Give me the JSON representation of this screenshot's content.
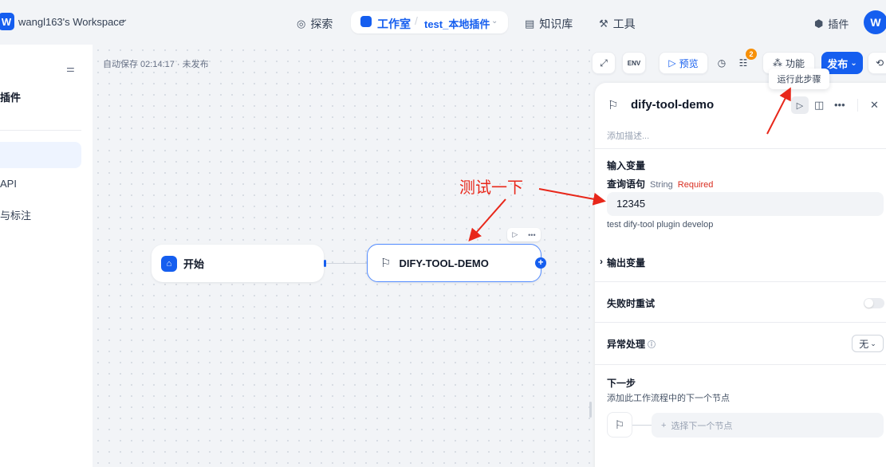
{
  "header": {
    "workspace_initial": "W",
    "workspace_name": "wangl163's Workspace",
    "nav_explore": "探索",
    "nav_studio": "工作室",
    "app_name": "test_本地插件",
    "nav_knowledge": "知识库",
    "nav_tools": "工具",
    "plugins": "插件",
    "user_initial": "W"
  },
  "sidebar": {
    "title": "插件",
    "items": [
      {
        "label": "API"
      },
      {
        "label": "与标注"
      }
    ]
  },
  "canvas": {
    "autosave": "自动保存 02:14:17 · 未发布",
    "start_node": "开始",
    "tool_node": "DIFY-TOOL-DEMO",
    "annotation": "测试一下"
  },
  "toolbar": {
    "preview": "预览",
    "checklist_badge": "2",
    "features": "功能",
    "publish": "发布",
    "env": "ENV",
    "tooltip": "运行此步骤"
  },
  "panel": {
    "title": "dify-tool-demo",
    "description_placeholder": "添加描述...",
    "input_vars_title": "输入变量",
    "var_name": "查询语句",
    "var_type": "String",
    "var_required": "Required",
    "var_value": "12345",
    "var_help": "test dify-tool plugin develop",
    "output_vars_title": "输出变量",
    "retry_title": "失败时重试",
    "error_title": "异常处理",
    "error_value": "无",
    "next_step_title": "下一步",
    "next_step_sub": "添加此工作流程中的下一个节点",
    "next_step_select": "选择下一个节点"
  },
  "colors": {
    "accent": "#155eef",
    "annotation": "#e8271a",
    "badge": "#f79009"
  }
}
